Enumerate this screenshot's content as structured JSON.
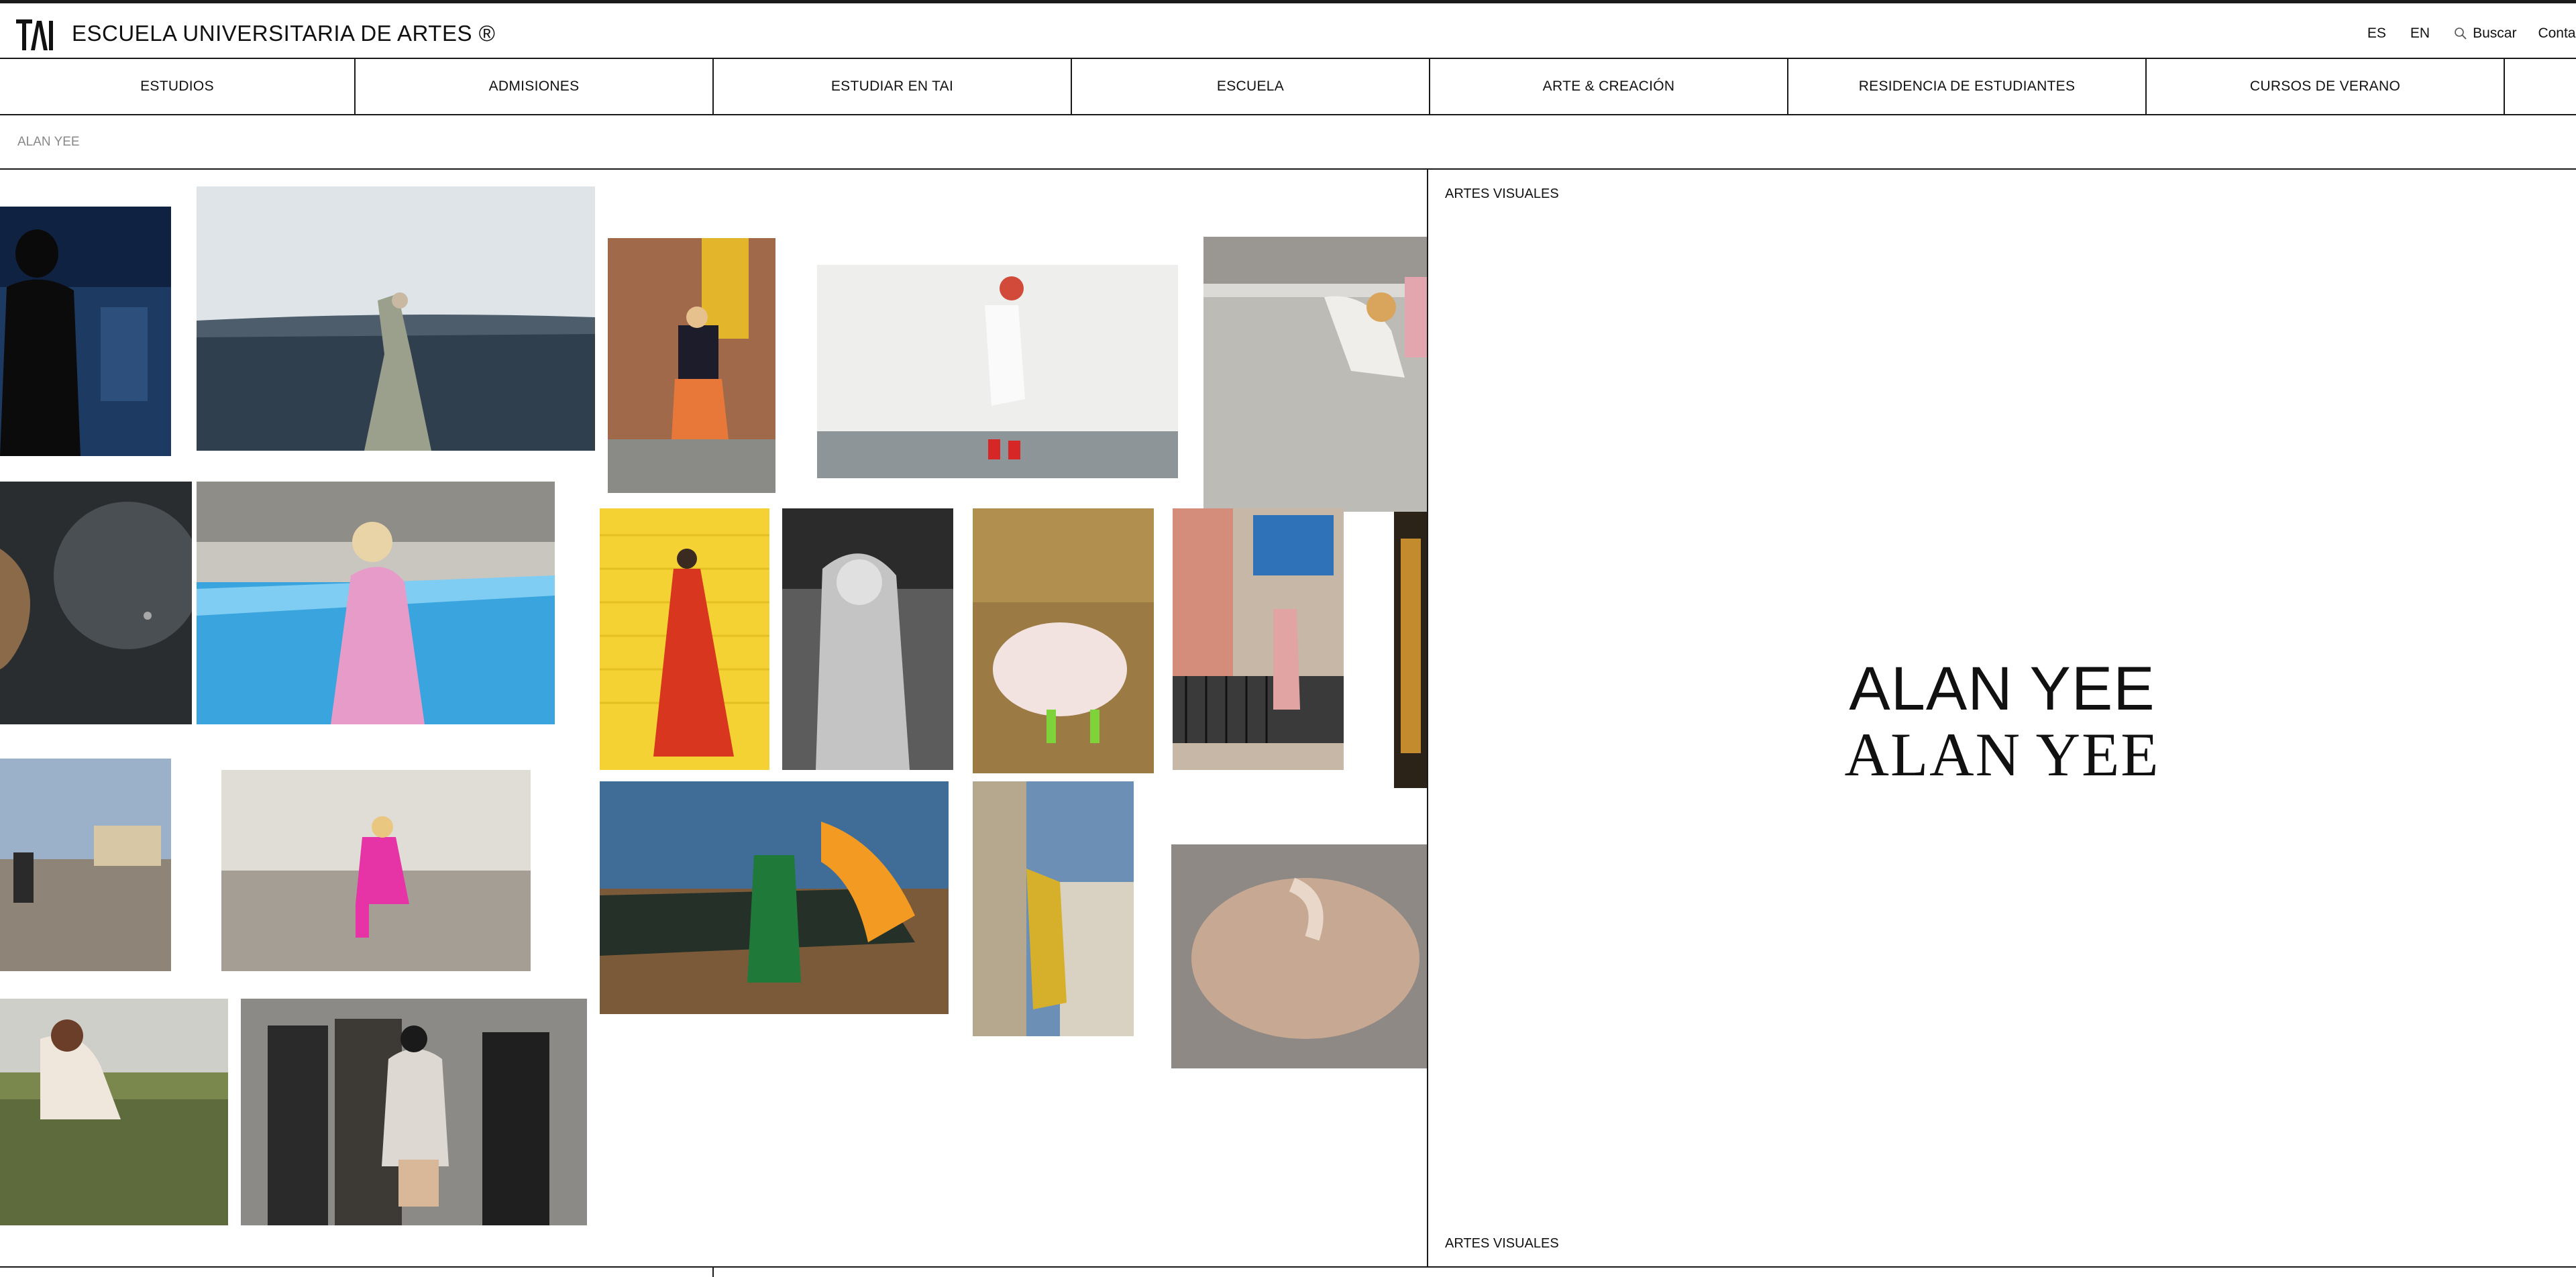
{
  "header": {
    "logo_text": "TAI",
    "title": "ESCUELA UNIVERSITARIA DE ARTES",
    "registered_mark": "®",
    "lang_es": "ES",
    "lang_en": "EN",
    "search_label": "Buscar",
    "contact_label": "Contac"
  },
  "nav": {
    "items": [
      {
        "label": "ESTUDIOS"
      },
      {
        "label": "ADMISIONES"
      },
      {
        "label": "ESTUDIAR EN TAI"
      },
      {
        "label": "ESCUELA"
      },
      {
        "label": "ARTE & CREACIÓN"
      },
      {
        "label": "RESIDENCIA DE ESTUDIANTES"
      },
      {
        "label": "CURSOS DE VERANO"
      }
    ]
  },
  "breadcrumb": {
    "current": "ALAN YEE"
  },
  "artist": {
    "category_top": "ARTES VISUALES",
    "name_sans": "ALAN YEE",
    "name_serif": "ALAN YEE",
    "category_bottom": "ARTES VISUALES"
  },
  "icons": {
    "search": "search-icon",
    "logo": "tai-logo"
  },
  "colors": {
    "border": "#1a1a1a",
    "muted_text": "#888888",
    "background": "#ffffff"
  }
}
